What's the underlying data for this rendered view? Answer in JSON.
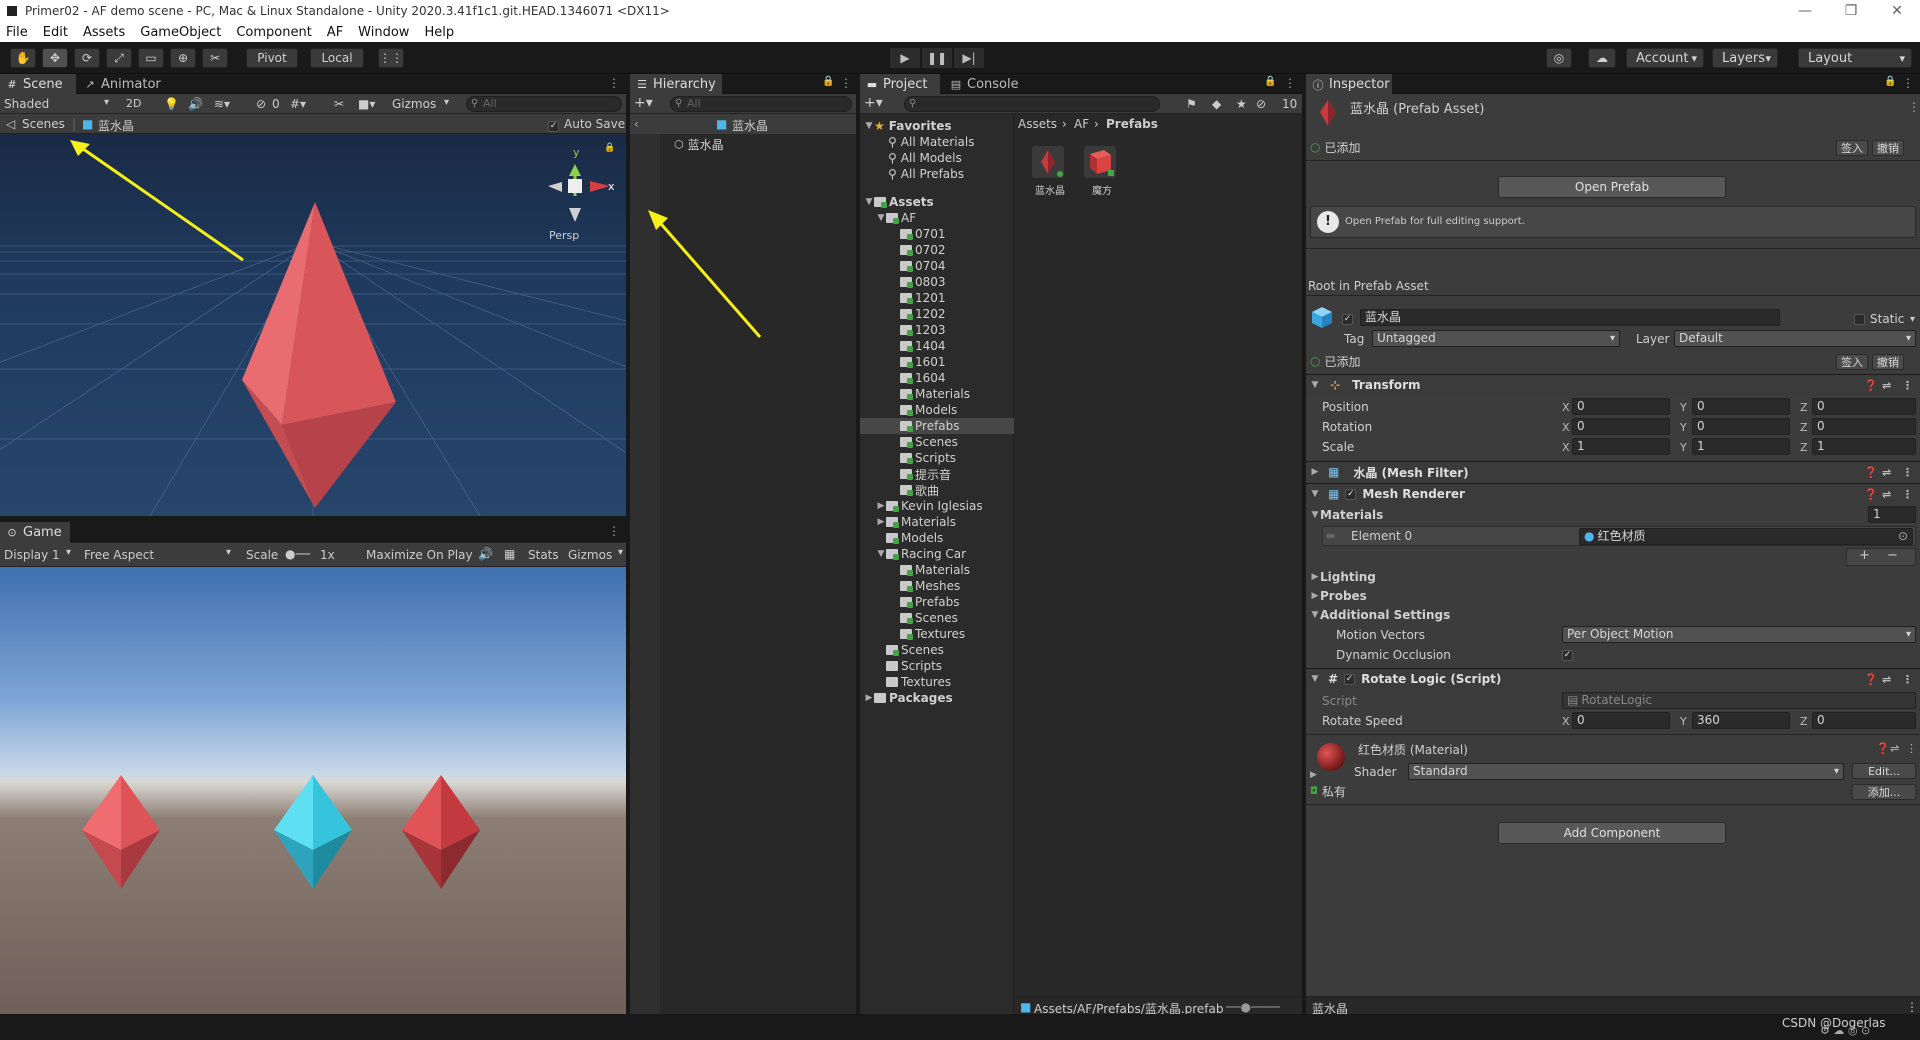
{
  "window": {
    "title": "Primer02 - AF demo scene - PC, Mac & Linux Standalone - Unity 2020.3.41f1c1.git.HEAD.1346071 <DX11>"
  },
  "menu": [
    "File",
    "Edit",
    "Assets",
    "GameObject",
    "Component",
    "AF",
    "Window",
    "Help"
  ],
  "toolbar": {
    "pivot": "Pivot",
    "local": "Local",
    "account": "Account",
    "layers": "Layers",
    "layout": "Layout"
  },
  "scene": {
    "tab_scene": "Scene",
    "tab_animator": "Animator",
    "shading": "Shaded",
    "mode2d": "2D",
    "hidden_count": "0",
    "gizmos": "Gizmos",
    "search_placeholder": "All",
    "breadcrumb_scenes": "Scenes",
    "breadcrumb_prefab": "蓝水晶",
    "auto_save": "Auto Save",
    "persp": "Persp",
    "axis_x": "x",
    "axis_y": "y"
  },
  "game": {
    "tab": "Game",
    "display": "Display 1",
    "aspect": "Free Aspect",
    "scale_label": "Scale",
    "scale_value": "1x",
    "maximize": "Maximize On Play",
    "stats": "Stats",
    "gizmos": "Gizmos"
  },
  "hierarchy": {
    "tab": "Hierarchy",
    "search_placeholder": "All",
    "root": "蓝水晶",
    "child": "蓝水晶"
  },
  "project": {
    "tab_project": "Project",
    "tab_console": "Console",
    "hidden_count": "10",
    "favorites": {
      "label": "Favorites",
      "items": [
        "All Materials",
        "All Models",
        "All Prefabs"
      ]
    },
    "assets_label": "Assets",
    "af_label": "AF",
    "af_children": [
      "0701",
      "0702",
      "0704",
      "0803",
      "1201",
      "1202",
      "1203",
      "1404",
      "1601",
      "1604",
      "Materials",
      "Models",
      "Prefabs",
      "Scenes",
      "Scripts",
      "提示音",
      "歌曲"
    ],
    "assets_more": [
      "Kevin Iglesias",
      "Materials",
      "Models"
    ],
    "racing_car": "Racing Car",
    "racing_children": [
      "Materials",
      "Meshes",
      "Prefabs",
      "Scenes",
      "Textures"
    ],
    "assets_tail": [
      "Scenes",
      "Scripts",
      "Textures"
    ],
    "packages": "Packages",
    "breadcrumb": [
      "Assets",
      "AF",
      "Prefabs"
    ],
    "grid_items": [
      "蓝水晶",
      "魔方"
    ],
    "footer_path": "Assets/AF/Prefabs/蓝水晶.prefab"
  },
  "inspector": {
    "tab": "Inspector",
    "title": "蓝水晶 (Prefab Asset)",
    "added": "已添加",
    "checkin": "签入",
    "revert": "撤销",
    "open_prefab": "Open Prefab",
    "help_text": "Open Prefab for full editing support.",
    "root_label": "Root in Prefab Asset",
    "object_name": "蓝水晶",
    "static_label": "Static",
    "tag_label": "Tag",
    "tag_value": "Untagged",
    "layer_label": "Layer",
    "layer_value": "Default",
    "transform": {
      "header": "Transform",
      "rows": [
        {
          "label": "Position",
          "x": "0",
          "y": "0",
          "z": "0"
        },
        {
          "label": "Rotation",
          "x": "0",
          "y": "0",
          "z": "0"
        },
        {
          "label": "Scale",
          "x": "1",
          "y": "1",
          "z": "1"
        }
      ]
    },
    "mesh_filter": "水晶 (Mesh Filter)",
    "mesh_renderer": "Mesh Renderer",
    "materials_label": "Materials",
    "materials_count": "1",
    "element0_label": "Element 0",
    "element0_value": "红色材质",
    "lighting": "Lighting",
    "probes": "Probes",
    "additional": "Additional Settings",
    "motion_vectors_label": "Motion Vectors",
    "motion_vectors_value": "Per Object Motion",
    "dynamic_occlusion_label": "Dynamic Occlusion",
    "script_header": "Rotate Logic (Script)",
    "script_label": "Script",
    "script_value": "RotateLogic",
    "rotate_speed_label": "Rotate Speed",
    "rotate_x": "0",
    "rotate_y": "360",
    "rotate_z": "0",
    "material_title": "红色材质 (Material)",
    "shader_label": "Shader",
    "shader_value": "Standard",
    "edit_btn": "Edit...",
    "private_label": "私有",
    "add_btn": "添加...",
    "add_component": "Add Component",
    "footer_name": "蓝水晶"
  },
  "status": {
    "watermark": "CSDN @Dogerlas"
  },
  "colors": {
    "red_crystal": "#e05a5e",
    "cyan_crystal": "#39c6dc",
    "annotation_arrow": "#f6f01a"
  }
}
